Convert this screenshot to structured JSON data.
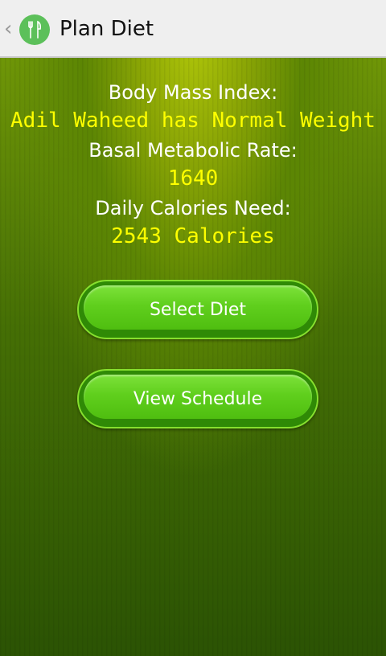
{
  "action_bar": {
    "title": "Plan Diet",
    "up_icon": "chevron-left-icon",
    "app_icon": "utensils-icon"
  },
  "stats": {
    "bmi_label": "Body Mass Index:",
    "bmi_value": "Adil Waheed has Normal Weight",
    "bmr_label": "Basal Metabolic Rate:",
    "bmr_value": "1640",
    "calories_label": "Daily Calories Need:",
    "calories_value": "2543 Calories"
  },
  "buttons": {
    "select_diet": "Select Diet",
    "view_schedule": "View Schedule"
  },
  "colors": {
    "value_text": "#ffff00",
    "label_text": "#ffffff",
    "button_green": "#60cf1d"
  }
}
